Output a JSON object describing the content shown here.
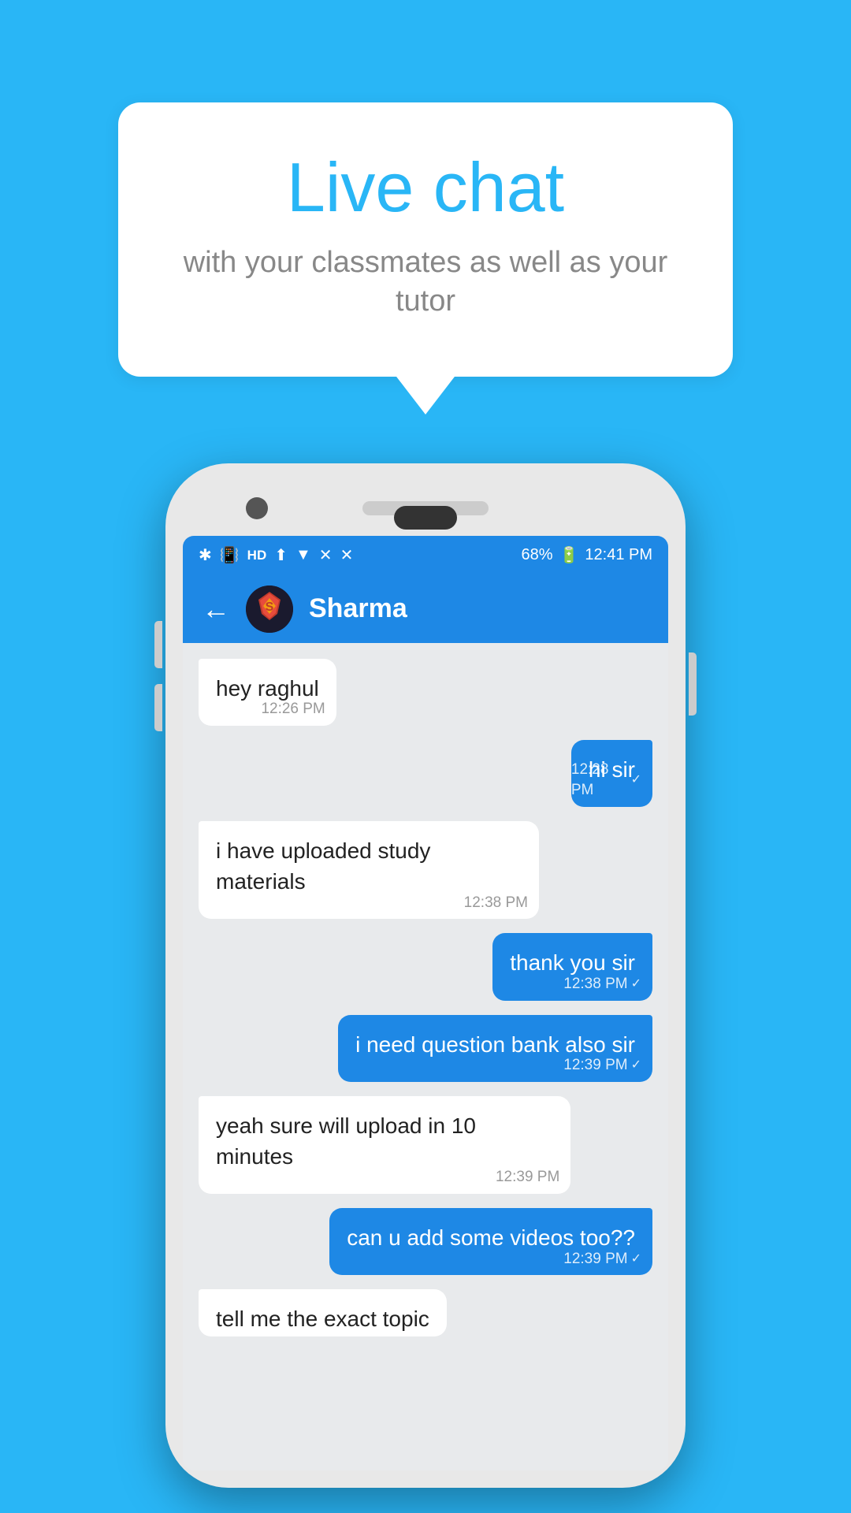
{
  "background_color": "#29B6F6",
  "bubble": {
    "title": "Live chat",
    "subtitle": "with your classmates as well as your tutor"
  },
  "phone": {
    "status_bar": {
      "time": "12:41 PM",
      "battery": "68%",
      "icons": [
        "bluetooth",
        "vibrate",
        "hd",
        "wifi",
        "signal",
        "no-signal",
        "battery"
      ]
    },
    "chat_header": {
      "back_label": "←",
      "contact_name": "Sharma",
      "avatar_emoji": "🛡️"
    },
    "messages": [
      {
        "id": "msg1",
        "type": "received",
        "text": "hey raghul",
        "time": "12:26 PM",
        "has_check": false
      },
      {
        "id": "msg2",
        "type": "sent",
        "text": "hi sir",
        "time": "12:28 PM",
        "has_check": true
      },
      {
        "id": "msg3",
        "type": "received",
        "text": "i have uploaded study materials",
        "time": "12:38 PM",
        "has_check": false
      },
      {
        "id": "msg4",
        "type": "sent",
        "text": "thank you sir",
        "time": "12:38 PM",
        "has_check": true
      },
      {
        "id": "msg5",
        "type": "sent",
        "text": "i need question bank also sir",
        "time": "12:39 PM",
        "has_check": true
      },
      {
        "id": "msg6",
        "type": "received",
        "text": "yeah sure will upload in 10 minutes",
        "time": "12:39 PM",
        "has_check": false
      },
      {
        "id": "msg7",
        "type": "sent",
        "text": "can u add some videos too??",
        "time": "12:39 PM",
        "has_check": true
      },
      {
        "id": "msg8",
        "type": "received",
        "text": "tell me the exact topic",
        "time": "",
        "has_check": false,
        "partial": true
      }
    ]
  }
}
